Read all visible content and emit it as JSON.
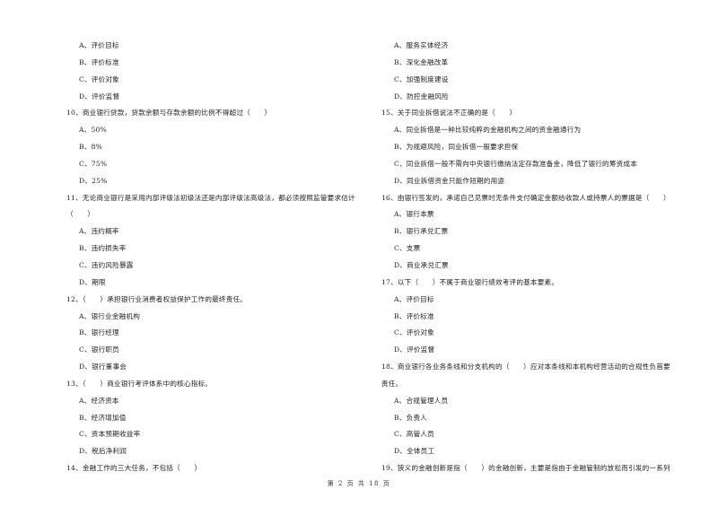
{
  "left_column": [
    {
      "type": "option",
      "text": "A、评价目标"
    },
    {
      "type": "option",
      "text": "B、评价标准"
    },
    {
      "type": "option",
      "text": "C、评价对象"
    },
    {
      "type": "option",
      "text": "D、评价监督"
    },
    {
      "type": "question",
      "text": "10、商业银行贷款，贷款余额与存款余额的比例不得超过（　　）"
    },
    {
      "type": "option",
      "text": "A、50%"
    },
    {
      "type": "option",
      "text": "B、8%"
    },
    {
      "type": "option",
      "text": "C、75%"
    },
    {
      "type": "option",
      "text": "D、25%"
    },
    {
      "type": "question",
      "text": "11、无论商业银行是采用内部评级法初级法还是内部评级法高级法，都必须按照监管要求估计"
    },
    {
      "type": "question",
      "text": "（　　）"
    },
    {
      "type": "option",
      "text": "A、违约概率"
    },
    {
      "type": "option",
      "text": "B、违约损失率"
    },
    {
      "type": "option",
      "text": "C、违约风险暴露"
    },
    {
      "type": "option",
      "text": "D、期限"
    },
    {
      "type": "question",
      "text": "12、（　　）承担银行业消费者权益保护工作的最终责任。"
    },
    {
      "type": "option",
      "text": "A、银行业金融机构"
    },
    {
      "type": "option",
      "text": "B、银行经理"
    },
    {
      "type": "option",
      "text": "C、银行职员"
    },
    {
      "type": "option",
      "text": "D、银行董事会"
    },
    {
      "type": "question",
      "text": "13、（　　）商业银行考评体系中的核心指标。"
    },
    {
      "type": "option",
      "text": "A、经济资本"
    },
    {
      "type": "option",
      "text": "B、经济增加值"
    },
    {
      "type": "option",
      "text": "C、资本预期收益率"
    },
    {
      "type": "option",
      "text": "D、税后净利润"
    },
    {
      "type": "question",
      "text": "14、金融工作的三大任务，不包括（　　）"
    }
  ],
  "right_column": [
    {
      "type": "option",
      "text": "A、服务实体经济"
    },
    {
      "type": "option",
      "text": "B、深化金融改革"
    },
    {
      "type": "option",
      "text": "C、加强制度建设"
    },
    {
      "type": "option",
      "text": "D、防控金融风险"
    },
    {
      "type": "question",
      "text": "15、关于同业拆借说法不正确的是（　　）"
    },
    {
      "type": "option",
      "text": "A、同业拆借是一种比较纯粹的金融机构之间的资金融通行为"
    },
    {
      "type": "option",
      "text": "B、为规避风险，同业拆借一般要求担保"
    },
    {
      "type": "option",
      "text": "C、同业拆借一般不需向中央银行缴纳法定存款准备金，降低了银行的筹资成本"
    },
    {
      "type": "option",
      "text": "D、同业拆借资金只能作短期的用途"
    },
    {
      "type": "question",
      "text": "16、由银行签发的，承诺自己见票时无条件支付确定金额给收款人或持票人的票据是（　　）"
    },
    {
      "type": "option",
      "text": "A、银行本票"
    },
    {
      "type": "option",
      "text": "B、银行承兑汇票"
    },
    {
      "type": "option",
      "text": "C、支票"
    },
    {
      "type": "option",
      "text": "D、商业承兑汇票"
    },
    {
      "type": "question",
      "text": "17、以下（　　）不属于商业银行绩效考评的基本要素。"
    },
    {
      "type": "option",
      "text": "A、评价目标"
    },
    {
      "type": "option",
      "text": "B、评价标准"
    },
    {
      "type": "option",
      "text": "C、评价对象"
    },
    {
      "type": "option",
      "text": "D、评价监督"
    },
    {
      "type": "question",
      "text": "18、商业银行各业务条线和分支机构的（　　）应对本条线和本机构经营活动的合规性负首要"
    },
    {
      "type": "question",
      "text": "责任。"
    },
    {
      "type": "option",
      "text": "A、合规管理人员"
    },
    {
      "type": "option",
      "text": "B、负责人"
    },
    {
      "type": "option",
      "text": "C、高管人员"
    },
    {
      "type": "option",
      "text": "D、全体员工"
    },
    {
      "type": "question",
      "text": "19、狭义的金融创新是指（　　）的金融创新，主要是指由于金融管制的放松而引发的一系列"
    }
  ],
  "footer": {
    "page_label": "第 2 页 共 18 页"
  }
}
